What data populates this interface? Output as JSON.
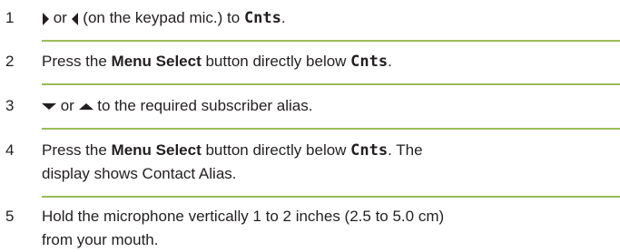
{
  "steps": [
    {
      "number": "1",
      "or_word": " or ",
      "paren_text": " (on the keypad mic.) to ",
      "screen_word": "Cnts",
      "end_punct": ".",
      "icons": [
        "right-arrow-icon",
        "left-arrow-icon"
      ]
    },
    {
      "number": "2",
      "pre": "Press the ",
      "bold": "Menu Select",
      "mid": " button directly below ",
      "screen_word": "Cnts",
      "end_punct": "."
    },
    {
      "number": "3",
      "or_word": " or ",
      "rest": " to the required subscriber alias.",
      "icons": [
        "down-arrow-icon",
        "up-arrow-icon"
      ]
    },
    {
      "number": "4",
      "pre": "Press the ",
      "bold": "Menu Select",
      "mid": " button directly below ",
      "screen_word": "Cnts",
      "after": ". The",
      "line2": "display shows Contact Alias."
    },
    {
      "number": "5",
      "line1": "Hold the microphone vertically 1 to 2 inches (2.5 to 5.0 cm)",
      "line2": "from your mouth."
    }
  ],
  "colors": {
    "divider": "#9bbb59",
    "text": "#231f20"
  }
}
